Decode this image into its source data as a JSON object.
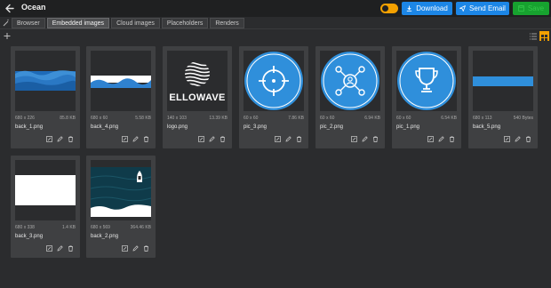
{
  "header": {
    "title": "Ocean",
    "toggle_color": "#f4a100",
    "buttons": {
      "download": "Download",
      "send_email": "Send Email",
      "save": "Save"
    },
    "icons": [
      "arrow-left-icon",
      "download-icon",
      "send-icon",
      "save-icon"
    ]
  },
  "tabs": [
    "Browser",
    "Embedded images",
    "Cloud images",
    "Placeholders",
    "Renders"
  ],
  "active_tab": "Embedded images",
  "view_mode": "grid",
  "images": [
    {
      "dims": "680 x 226",
      "size": "85.8 KB",
      "name": "back_1.png",
      "thumb": "waves-blue"
    },
    {
      "dims": "680 x 60",
      "size": "5.58 KB",
      "name": "back_4.png",
      "thumb": "wave-strip"
    },
    {
      "dims": "140 x 103",
      "size": "13.39 KB",
      "name": "logo.png",
      "thumb": "ellowave-logo",
      "logo_text": "ELLOWAVE"
    },
    {
      "dims": "60 x 60",
      "size": "7.86 KB",
      "name": "pic_3.png",
      "thumb": "target-icon"
    },
    {
      "dims": "60 x 60",
      "size": "6.94 KB",
      "name": "pic_2.png",
      "thumb": "user-network-icon"
    },
    {
      "dims": "60 x 60",
      "size": "6.54 KB",
      "name": "pic_1.png",
      "thumb": "trophy-icon"
    },
    {
      "dims": "680 x 113",
      "size": "540 Bytes",
      "name": "back_5.png",
      "thumb": "blue-bar"
    },
    {
      "dims": "680 x 338",
      "size": "1.4 KB",
      "name": "back_3.png",
      "thumb": "white-block"
    },
    {
      "dims": "680 x 569",
      "size": "364.46 KB",
      "name": "back_2.png",
      "thumb": "ocean-boat"
    }
  ],
  "colors": {
    "accent_blue": "#1c86e6",
    "save_green": "#17a22f",
    "icon_blue": "#2f8fdb"
  }
}
